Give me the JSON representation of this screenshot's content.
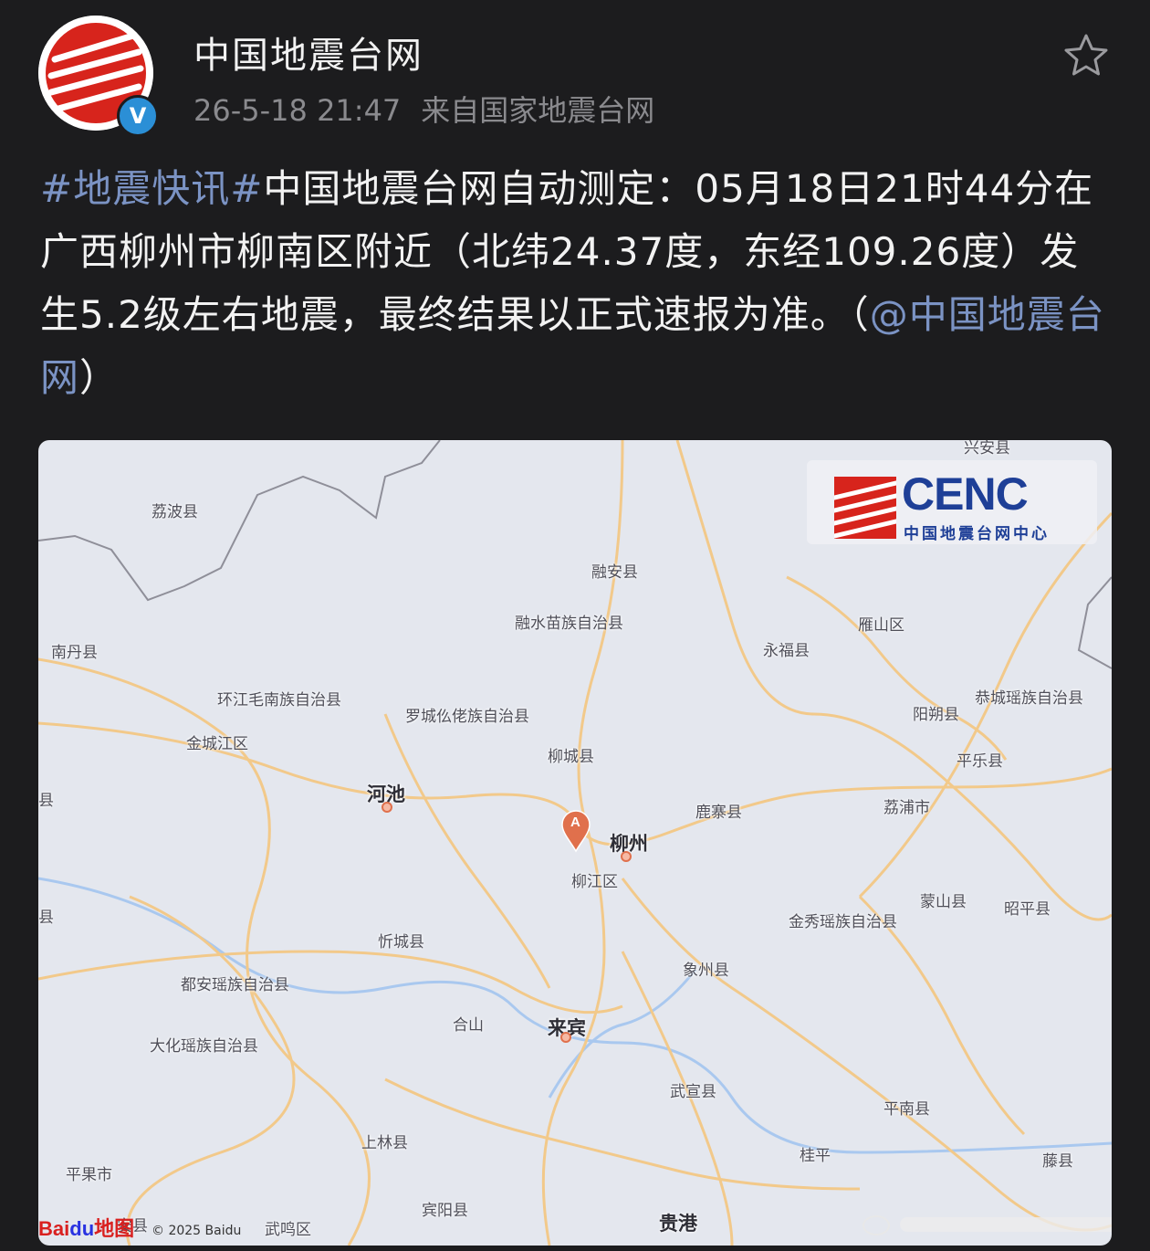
{
  "header": {
    "account_name": "中国地震台网",
    "timestamp": "26-5-18 21:47",
    "source": "来自国家地震台网",
    "verified_badge": "V",
    "star_icon": "star-outline-icon"
  },
  "post": {
    "hashtag": "#地震快讯#",
    "body": "中国地震台网自动测定：05月18日21时44分在广西柳州市柳南区附近（北纬24.37度，东经109.26度）发生5.2级左右地震，最终结果以正式速报为准。（",
    "mention": "@中国地震台网",
    "closing": "）"
  },
  "map": {
    "logo": {
      "name": "CENC",
      "subtitle": "中国地震台网中心"
    },
    "marker_label": "A",
    "places": {
      "xingan": "兴安县",
      "libo": "荔波县",
      "rongan": "融安县",
      "rongshui": "融水苗族自治县",
      "yanshan": "雁山区",
      "nandan": "南丹县",
      "yongfu": "永福县",
      "huanjiang": "环江毛南族自治县",
      "luocheng": "罗城仫佬族自治县",
      "gongcheng": "恭城瑶族自治县",
      "yangshuo": "阳朔县",
      "jinchengjiang": "金城江区",
      "liucheng": "柳城县",
      "pingle": "平乐县",
      "hechi": "河池",
      "luzhai": "鹿寨县",
      "lipu": "荔浦市",
      "liuzhou": "柳州",
      "liujiang": "柳江区",
      "mengshan": "蒙山县",
      "zhaoping": "昭平县",
      "jinxiu": "金秀瑶族自治县",
      "xincheng": "忻城县",
      "xiangzhou": "象州县",
      "duan": "都安瑶族自治县",
      "heshan": "合山",
      "laibin": "来宾",
      "dahua": "大化瑶族自治县",
      "wuxuan": "武宣县",
      "pingnan": "平南县",
      "shanglin": "上林县",
      "guiping": "桂平",
      "tengxian": "藤县",
      "pingguo": "平果市",
      "binyang": "宾阳县",
      "wuming": "武鸣区",
      "guigang": "贵港",
      "xian_left1": "县",
      "xian_left2": "县",
      "long_an": "安县"
    },
    "attribution": {
      "brand_bai": "Bai",
      "brand_du": "du",
      "brand_ditu": "地图",
      "copyright": "© 2025 Baidu"
    }
  },
  "colors": {
    "background": "#1c1c1e",
    "text": "#f2f2f2",
    "link": "#7b93c4",
    "meta": "#8a8a8e",
    "brand_red": "#d7241c",
    "cenc_blue": "#1e3f97",
    "road": "#f2c98a",
    "marker": "#e0704c"
  }
}
